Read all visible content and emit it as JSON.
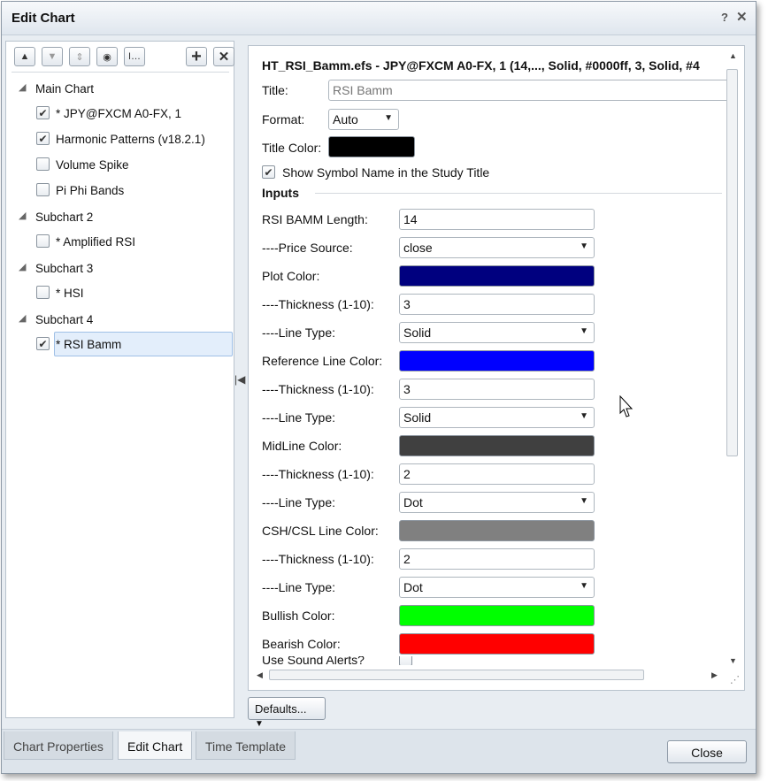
{
  "window": {
    "title": "Edit Chart",
    "help": "?",
    "close": "✕"
  },
  "toolbar": {
    "up": "▲",
    "down": "▼",
    "move": "⇕",
    "eye": "◉",
    "text": "I…",
    "add": "+",
    "remove": "✕"
  },
  "tree": {
    "main_chart": "Main Chart",
    "item_jpy": "* JPY@FXCM A0-FX, 1",
    "item_harmonic": "Harmonic Patterns (v18.2.1)",
    "item_volume": "Volume Spike",
    "item_pi": "Pi Phi Bands",
    "subchart2": "Subchart 2",
    "item_amplified": "* Amplified RSI",
    "subchart3": "Subchart 3",
    "item_hsi": "* HSI",
    "subchart4": "Subchart 4",
    "item_rsibamm": "* RSI Bamm"
  },
  "study": {
    "header": "HT_RSI_Bamm.efs - JPY@FXCM A0-FX, 1 (14,..., Solid, #0000ff, 3, Solid, #4",
    "title_label": "Title:",
    "title_placeholder": "RSI Bamm",
    "format_label": "Format:",
    "format_value": "Auto",
    "title_color_label": "Title Color:",
    "show_symbol_label": "Show Symbol Name in the Study Title",
    "inputs_section": "Inputs"
  },
  "inputs": {
    "length_label": "RSI BAMM Length:",
    "length_value": "14",
    "price_label": "----Price Source:",
    "price_value": "close",
    "plot_color_label": "Plot Color:",
    "thick1_label": "----Thickness (1-10):",
    "thick1_value": "3",
    "line1_label": "----Line Type:",
    "line1_value": "Solid",
    "ref_color_label": "Reference Line Color:",
    "thick2_label": "----Thickness (1-10):",
    "thick2_value": "3",
    "line2_label": "----Line Type:",
    "line2_value": "Solid",
    "mid_color_label": "MidLine Color:",
    "thick3_label": "----Thickness (1-10):",
    "thick3_value": "2",
    "line3_label": "----Line Type:",
    "line3_value": "Dot",
    "csh_color_label": "CSH/CSL Line Color:",
    "thick4_label": "----Thickness (1-10):",
    "thick4_value": "2",
    "line4_label": "----Line Type:",
    "line4_value": "Dot",
    "bull_label": "Bullish Color:",
    "bear_label": "Bearish Color:",
    "sound_label": "Use Sound Alerts?"
  },
  "colors": {
    "title_color": "#000000",
    "plot_color": "#00007f",
    "ref_color": "#0000ff",
    "mid_color": "#404040",
    "csh_color": "#808080",
    "bull_color": "#00ff00",
    "bear_color": "#ff0000"
  },
  "footer": {
    "defaults": "Defaults...",
    "close": "Close"
  },
  "tabs": {
    "props": "Chart Properties",
    "edit": "Edit Chart",
    "time": "Time Template"
  }
}
